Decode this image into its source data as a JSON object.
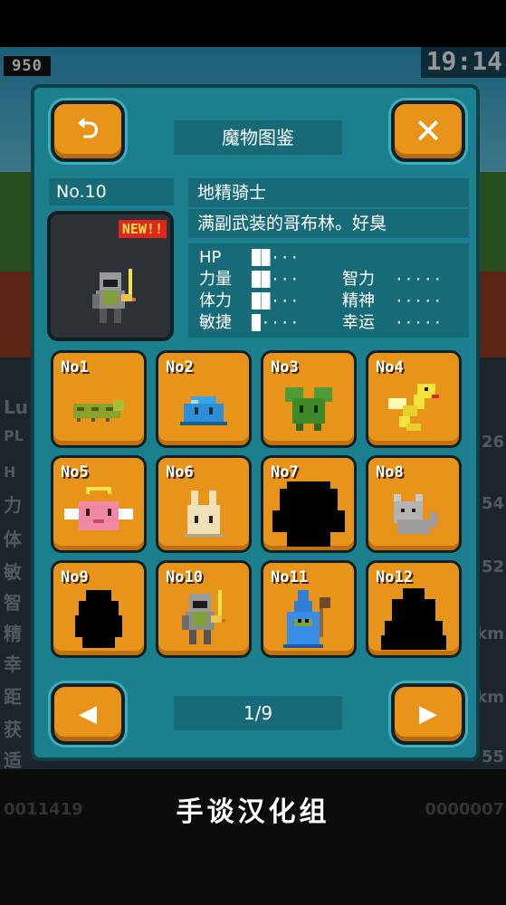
{
  "background": {
    "score": "950",
    "time": "19:14",
    "left_labels": [
      "Lu",
      "PL",
      "H",
      "力",
      "体",
      "敏",
      "智",
      "精",
      "幸",
      "距",
      "获",
      "适"
    ],
    "right_values": [
      "26",
      "54",
      "52",
      "km",
      "km",
      "55"
    ],
    "bottom_left": "0011419",
    "bottom_right": "0000007"
  },
  "modal": {
    "back_icon": "return-arrow-icon",
    "close_icon": "close-x-icon",
    "back_label": "⮌",
    "close_label": "✕",
    "title": "魔物图鉴",
    "number": "No.10",
    "monster_name": "地精骑士",
    "monster_desc": "满副武装的哥布林。好臭",
    "new_badge": "NEW!!",
    "stats": [
      {
        "label": "HP",
        "bar": "██···"
      },
      {
        "label": "力量",
        "bar": "██···"
      },
      {
        "label": "体力",
        "bar": "██···"
      },
      {
        "label": "敏捷",
        "bar": "█····"
      },
      {
        "label": "智力",
        "bar": "·····"
      },
      {
        "label": "精神",
        "bar": "·····"
      },
      {
        "label": "幸运",
        "bar": "·····"
      }
    ],
    "entries": [
      {
        "no": "No1",
        "sprite": "green-caterpillar"
      },
      {
        "no": "No2",
        "sprite": "blue-slime"
      },
      {
        "no": "No3",
        "sprite": "green-plant"
      },
      {
        "no": "No4",
        "sprite": "yellow-snake"
      },
      {
        "no": "No5",
        "sprite": "pink-angel"
      },
      {
        "no": "No6",
        "sprite": "beige-rabbit"
      },
      {
        "no": "No7",
        "sprite": "unknown-silhouette"
      },
      {
        "no": "No8",
        "sprite": "grey-cat"
      },
      {
        "no": "No9",
        "sprite": "unknown-silhouette"
      },
      {
        "no": "No10",
        "sprite": "goblin-knight"
      },
      {
        "no": "No11",
        "sprite": "blue-wizard"
      },
      {
        "no": "No12",
        "sprite": "unknown-silhouette"
      }
    ],
    "prev_label": "◀",
    "next_label": "▶",
    "page": "1/9"
  },
  "watermark": "手谈汉化组"
}
